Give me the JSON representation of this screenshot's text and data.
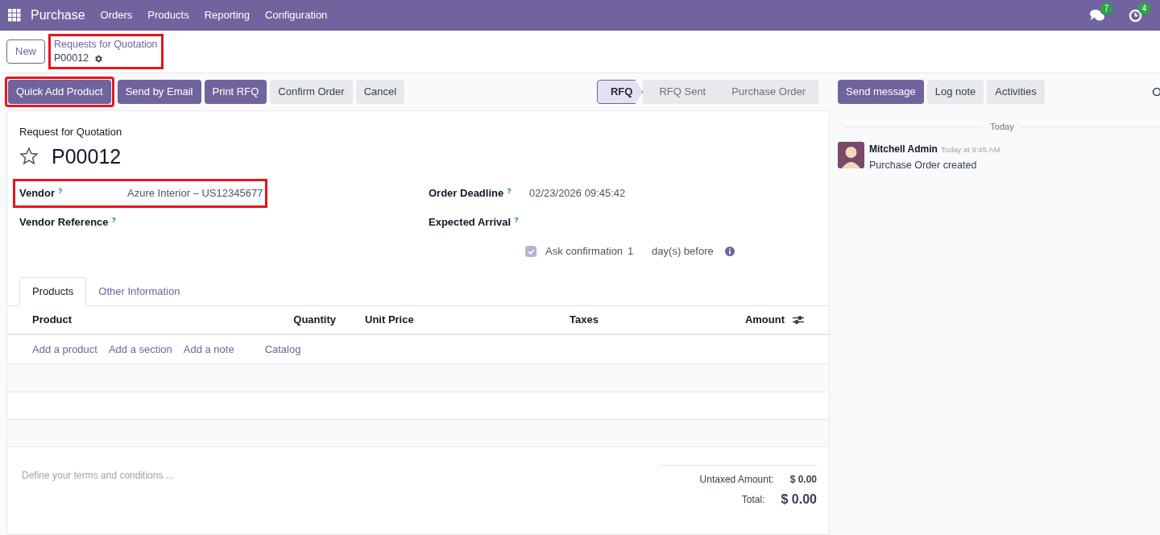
{
  "navbar": {
    "app": "Purchase",
    "menu": [
      "Orders",
      "Products",
      "Reporting",
      "Configuration"
    ],
    "badges": [
      {
        "kind": "chat",
        "count": "7"
      },
      {
        "kind": "activity",
        "count": "4"
      }
    ]
  },
  "breadcrumb": {
    "new_button": "New",
    "parent": "Requests for Quotation",
    "current": "P00012",
    "highlighted": true
  },
  "actions": [
    {
      "label": "Quick Add Product",
      "primary": true,
      "highlighted": true
    },
    {
      "label": "Send by Email",
      "primary": true
    },
    {
      "label": "Print RFQ",
      "primary": true
    },
    {
      "label": "Confirm Order",
      "primary": false
    },
    {
      "label": "Cancel",
      "primary": false
    }
  ],
  "status": [
    {
      "label": "RFQ",
      "selected": true
    },
    {
      "label": "RFQ Sent",
      "selected": false
    },
    {
      "label": "Purchase Order",
      "selected": false
    }
  ],
  "form": {
    "title_label": "Request for Quotation",
    "name": "P00012",
    "starred": false,
    "left_fields": [
      {
        "label": "Vendor",
        "help": "?",
        "value": "Azure Interior – US12345677",
        "highlighted": true
      },
      {
        "label": "Vendor Reference",
        "help": "?"
      }
    ],
    "right_fields": [
      {
        "label": "Order Deadline",
        "help": "?",
        "value": "02/23/2026 09:45:42"
      },
      {
        "label": "Expected Arrival",
        "help": "?"
      }
    ],
    "ask_confirmation": {
      "checked": true,
      "label": "Ask confirmation",
      "days": "1",
      "suffix": "day(s) before"
    },
    "tabs": [
      {
        "label": "Products",
        "selected": true
      },
      {
        "label": "Other Information",
        "selected": false
      }
    ],
    "columns": [
      "Product",
      "Quantity",
      "Unit Price",
      "Taxes",
      "Amount"
    ],
    "add_links": [
      "Add a product",
      "Add a section",
      "Add a note",
      "Catalog"
    ],
    "terms_placeholder": "Define your terms and conditions ...",
    "totals": [
      {
        "label": "Untaxed Amount:",
        "value": "$ 0.00",
        "kind": "subtotal"
      },
      {
        "label": "Total:",
        "value": "$ 0.00",
        "kind": "total"
      }
    ]
  },
  "chatter": {
    "buttons": [
      {
        "label": "Send message",
        "primary": true
      },
      {
        "label": "Log note",
        "primary": false
      },
      {
        "label": "Activities",
        "primary": false
      }
    ],
    "date_separator": "Today",
    "messages": [
      {
        "author": "Mitchell Admin",
        "time": "Today at 9:45 AM",
        "body": "Purchase Order created"
      }
    ]
  }
}
